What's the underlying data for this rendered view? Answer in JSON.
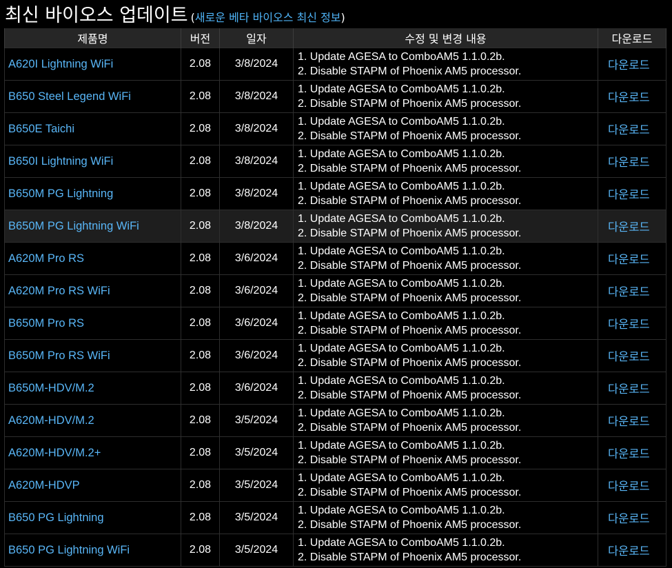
{
  "header": {
    "title": "최신 바이오스 업데이트",
    "paren_open": "(",
    "beta_link": "새로운 베타 바이오스 최신 정보",
    "paren_close": ")"
  },
  "colors": {
    "background": "#000000",
    "header_row": "#262626",
    "link": "#59b6f7",
    "text": "#ffffff",
    "highlight_row": "#1e1e1e"
  },
  "table": {
    "columns": [
      "제품명",
      "버전",
      "일자",
      "수정 및 변경 내용",
      "다운로드"
    ],
    "rows": [
      {
        "product": "A620I Lightning WiFi",
        "version": "2.08",
        "date": "3/8/2024",
        "desc1": "1. Update AGESA to ComboAM5 1.1.0.2b.",
        "desc2": "2. Disable STAPM of Phoenix AM5 processor.",
        "download": "다운로드"
      },
      {
        "product": "B650 Steel Legend WiFi",
        "version": "2.08",
        "date": "3/8/2024",
        "desc1": "1. Update AGESA to ComboAM5 1.1.0.2b.",
        "desc2": "2. Disable STAPM of Phoenix AM5 processor.",
        "download": "다운로드"
      },
      {
        "product": "B650E Taichi",
        "version": "2.08",
        "date": "3/8/2024",
        "desc1": "1. Update AGESA to ComboAM5 1.1.0.2b.",
        "desc2": "2. Disable STAPM of Phoenix AM5 processor.",
        "download": "다운로드"
      },
      {
        "product": "B650I Lightning WiFi",
        "version": "2.08",
        "date": "3/8/2024",
        "desc1": "1. Update AGESA to ComboAM5 1.1.0.2b.",
        "desc2": "2. Disable STAPM of Phoenix AM5 processor.",
        "download": "다운로드"
      },
      {
        "product": "B650M PG Lightning",
        "version": "2.08",
        "date": "3/8/2024",
        "desc1": "1. Update AGESA to ComboAM5 1.1.0.2b.",
        "desc2": "2. Disable STAPM of Phoenix AM5 processor.",
        "download": "다운로드"
      },
      {
        "product": "B650M PG Lightning WiFi",
        "version": "2.08",
        "date": "3/8/2024",
        "desc1": "1. Update AGESA to ComboAM5 1.1.0.2b.",
        "desc2": "2. Disable STAPM of Phoenix AM5 processor.",
        "download": "다운로드",
        "highlighted": true
      },
      {
        "product": "A620M Pro RS",
        "version": "2.08",
        "date": "3/6/2024",
        "desc1": "1. Update AGESA to ComboAM5 1.1.0.2b.",
        "desc2": "2. Disable STAPM of Phoenix AM5 processor.",
        "download": "다운로드"
      },
      {
        "product": "A620M Pro RS WiFi",
        "version": "2.08",
        "date": "3/6/2024",
        "desc1": "1. Update AGESA to ComboAM5 1.1.0.2b.",
        "desc2": "2. Disable STAPM of Phoenix AM5 processor.",
        "download": "다운로드"
      },
      {
        "product": "B650M Pro RS",
        "version": "2.08",
        "date": "3/6/2024",
        "desc1": "1. Update AGESA to ComboAM5 1.1.0.2b.",
        "desc2": "2. Disable STAPM of Phoenix AM5 processor.",
        "download": "다운로드"
      },
      {
        "product": "B650M Pro RS WiFi",
        "version": "2.08",
        "date": "3/6/2024",
        "desc1": "1. Update AGESA to ComboAM5 1.1.0.2b.",
        "desc2": "2. Disable STAPM of Phoenix AM5 processor.",
        "download": "다운로드"
      },
      {
        "product": "B650M-HDV/M.2",
        "version": "2.08",
        "date": "3/6/2024",
        "desc1": "1. Update AGESA to ComboAM5 1.1.0.2b.",
        "desc2": "2. Disable STAPM of Phoenix AM5 processor.",
        "download": "다운로드"
      },
      {
        "product": "A620M-HDV/M.2",
        "version": "2.08",
        "date": "3/5/2024",
        "desc1": "1. Update AGESA to ComboAM5 1.1.0.2b.",
        "desc2": "2. Disable STAPM of Phoenix AM5 processor.",
        "download": "다운로드"
      },
      {
        "product": "A620M-HDV/M.2+",
        "version": "2.08",
        "date": "3/5/2024",
        "desc1": "1. Update AGESA to ComboAM5 1.1.0.2b.",
        "desc2": "2. Disable STAPM of Phoenix AM5 processor.",
        "download": "다운로드"
      },
      {
        "product": "A620M-HDVP",
        "version": "2.08",
        "date": "3/5/2024",
        "desc1": "1. Update AGESA to ComboAM5 1.1.0.2b.",
        "desc2": "2. Disable STAPM of Phoenix AM5 processor.",
        "download": "다운로드"
      },
      {
        "product": "B650 PG Lightning",
        "version": "2.08",
        "date": "3/5/2024",
        "desc1": "1. Update AGESA to ComboAM5 1.1.0.2b.",
        "desc2": "2. Disable STAPM of Phoenix AM5 processor.",
        "download": "다운로드"
      },
      {
        "product": "B650 PG Lightning WiFi",
        "version": "2.08",
        "date": "3/5/2024",
        "desc1": "1. Update AGESA to ComboAM5 1.1.0.2b.",
        "desc2": "2. Disable STAPM of Phoenix AM5 processor.",
        "download": "다운로드"
      }
    ]
  }
}
